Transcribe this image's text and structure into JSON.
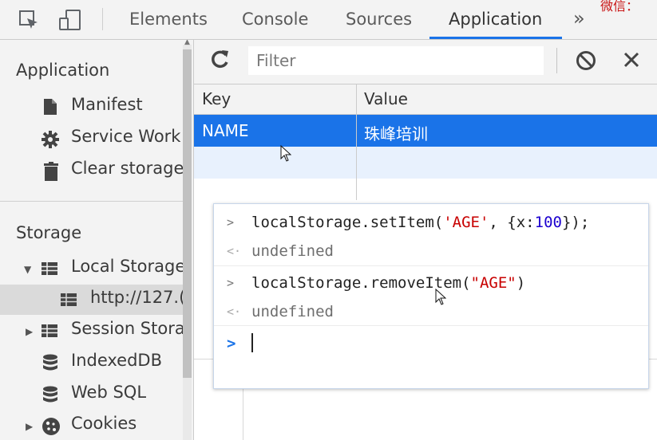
{
  "toolbar": {
    "tabs": [
      "Elements",
      "Console",
      "Sources",
      "Application"
    ],
    "active_tab": "Application",
    "more_label": "»",
    "overlay_text": "微信：",
    "accent_color": "#1a73e8"
  },
  "sidebar": {
    "application_heading": "Application",
    "application_items": [
      "Manifest",
      "Service Work",
      "Clear storage"
    ],
    "storage_heading": "Storage",
    "storage_items": [
      {
        "label": "Local Storage",
        "expanded": true
      },
      {
        "label": "http://127.(",
        "selected": true
      },
      {
        "label": "Session Stora",
        "expanded": false
      },
      {
        "label": "IndexedDB"
      },
      {
        "label": "Web SQL"
      },
      {
        "label": "Cookies",
        "expanded": false
      }
    ]
  },
  "storage": {
    "filter_placeholder": "Filter",
    "columns": [
      "Key",
      "Value"
    ],
    "rows": [
      {
        "key": "NAME",
        "value": "珠峰培训",
        "selected": true
      }
    ],
    "selection_color": "#1a73e8"
  },
  "console": {
    "lines": [
      {
        "type": "input",
        "prefix": ">",
        "code": [
          {
            "t": "plain",
            "v": "localStorage.setItem("
          },
          {
            "t": "str",
            "v": "'AGE'"
          },
          {
            "t": "plain",
            "v": ", {x:"
          },
          {
            "t": "num",
            "v": "100"
          },
          {
            "t": "plain",
            "v": "});"
          }
        ]
      },
      {
        "type": "output",
        "prefix": "<·",
        "text": "undefined"
      },
      {
        "type": "input",
        "prefix": ">",
        "code": [
          {
            "t": "plain",
            "v": "localStorage.removeItem("
          },
          {
            "t": "str",
            "v": "\"AGE\""
          },
          {
            "t": "plain",
            "v": ")"
          }
        ]
      },
      {
        "type": "output",
        "prefix": "<·",
        "text": "undefined"
      }
    ],
    "prompt": ">"
  }
}
